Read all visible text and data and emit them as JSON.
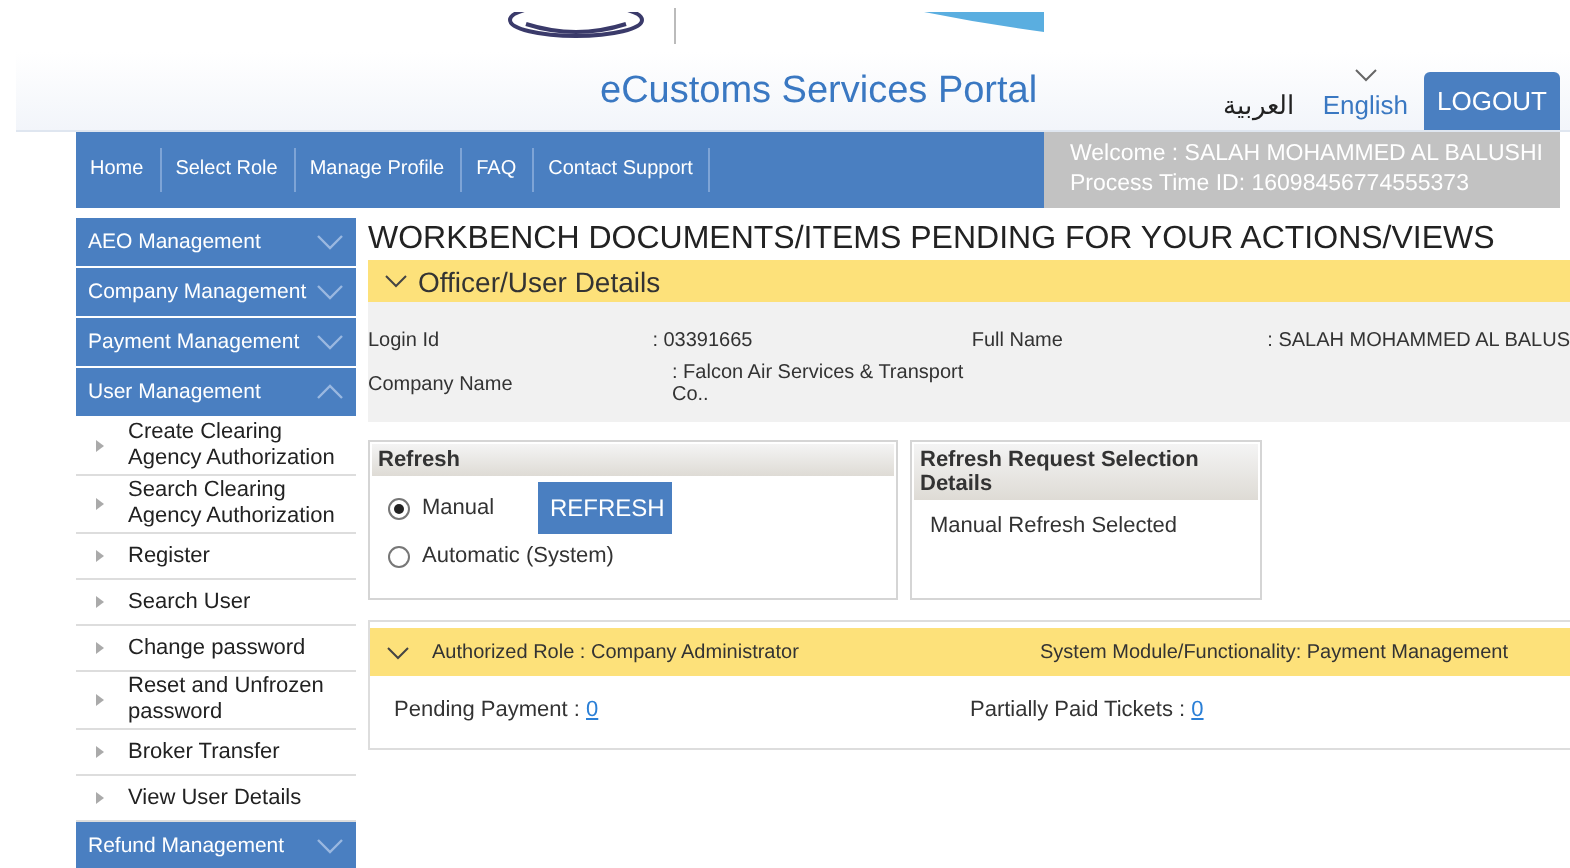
{
  "header": {
    "title": "eCustoms Services Portal",
    "languages": [
      {
        "label": "العربية",
        "selected": false
      },
      {
        "label": "English",
        "selected": true
      }
    ],
    "logout": "LOGOUT"
  },
  "nav": {
    "items": [
      "Home",
      "Select Role",
      "Manage Profile",
      "FAQ",
      "Contact Support"
    ],
    "welcome": "Welcome : SALAH MOHAMMED AL BALUSHI",
    "process_time": "Process Time ID: 16098456774555373"
  },
  "sidebar": {
    "menus": [
      {
        "label": "AEO Management",
        "expanded": false
      },
      {
        "label": "Company Management",
        "expanded": false
      },
      {
        "label": "Payment Management",
        "expanded": false
      },
      {
        "label": "User Management",
        "expanded": true,
        "children": [
          "Create Clearing Agency Authorization",
          "Search Clearing Agency Authorization",
          "Register",
          "Search User",
          "Change password",
          "Reset and Unfrozen password",
          "Broker Transfer",
          "View User Details"
        ]
      },
      {
        "label": "Refund Management",
        "expanded": false
      }
    ]
  },
  "page_title": "WORKBENCH DOCUMENTS/ITEMS PENDING FOR YOUR ACTIONS/VIEWS",
  "officer": {
    "heading": "Officer/User Details",
    "login_id_label": "Login Id",
    "login_id": ": 03391665",
    "full_name_label": "Full Name",
    "full_name": ": SALAH MOHAMMED AL BALUS",
    "company_label": "Company Name",
    "company": ": Falcon Air Services & Transport Co.."
  },
  "refresh": {
    "heading": "Refresh",
    "options": [
      {
        "label": "Manual",
        "selected": true
      },
      {
        "label": "Automatic (System)",
        "selected": false
      }
    ],
    "button": "REFRESH",
    "details_heading": "Refresh Request Selection Details",
    "details_text": "Manual Refresh Selected"
  },
  "role": {
    "role_text": "Authorized Role : Company Administrator",
    "module_text": "System Module/Functionality: Payment Management",
    "counts": [
      {
        "label": "Pending Payment : ",
        "value": "0"
      },
      {
        "label": "Partially Paid Tickets : ",
        "value": "0"
      }
    ]
  }
}
